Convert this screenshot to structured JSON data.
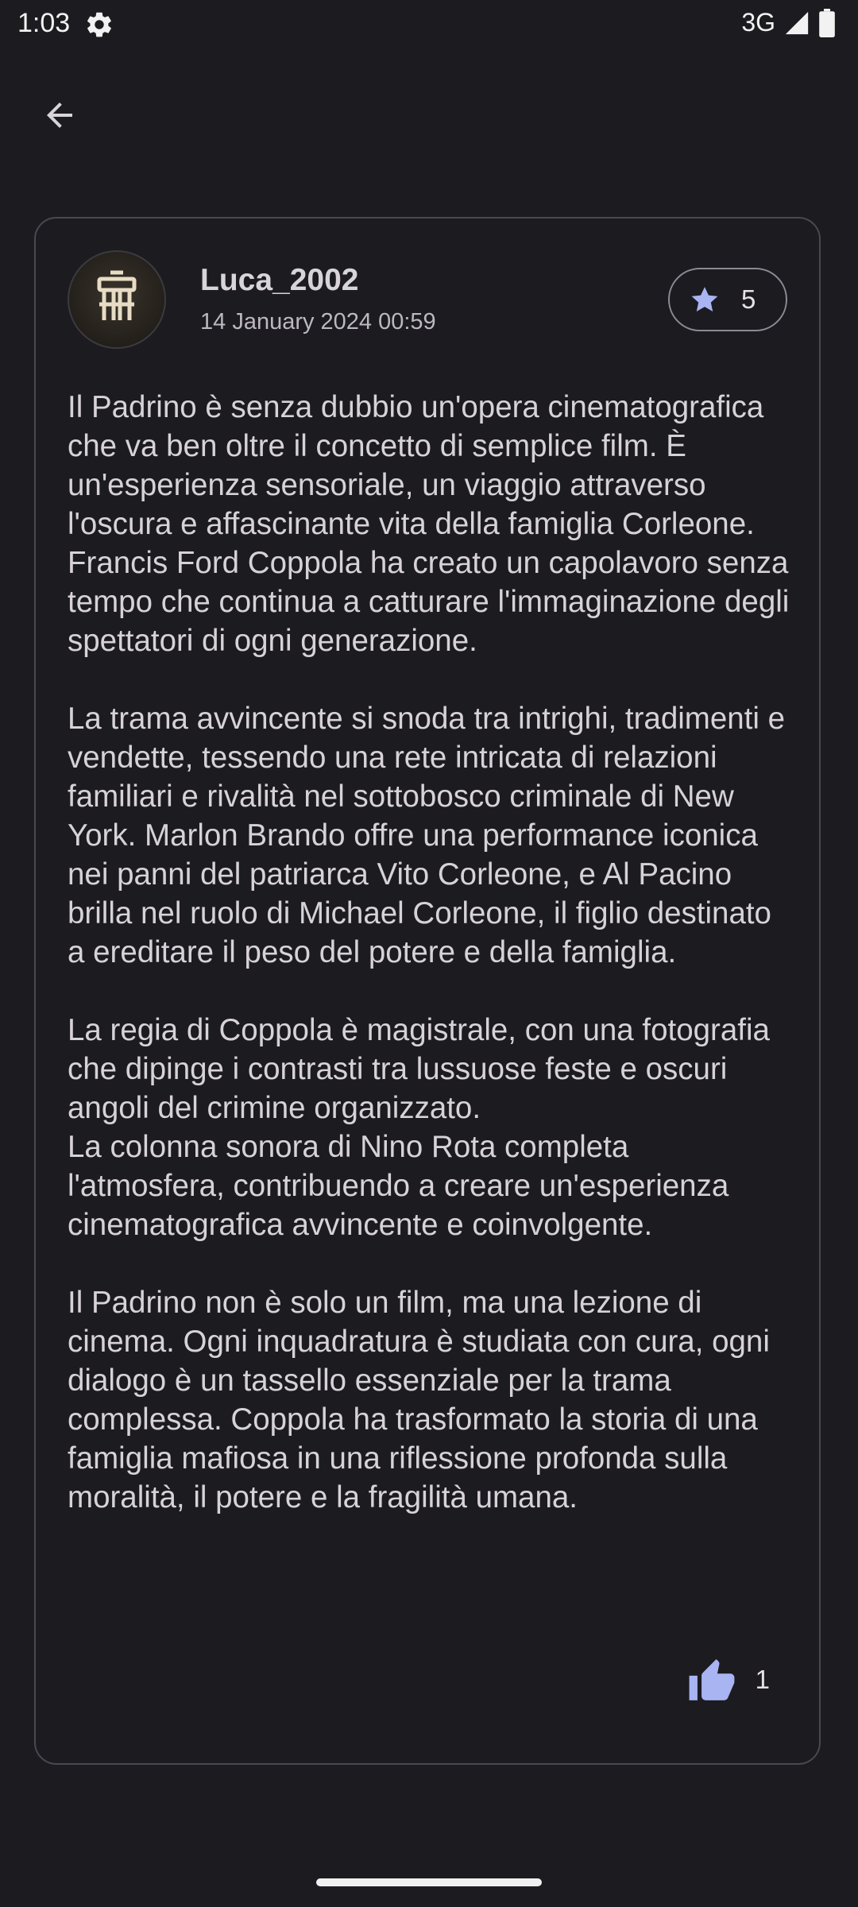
{
  "status_bar": {
    "time": "1:03",
    "network": "3G",
    "icons": [
      "gear-icon",
      "signal-icon",
      "battery-icon"
    ]
  },
  "nav": {
    "back_icon": "arrow-left-icon"
  },
  "review": {
    "username": "Luca_2002",
    "timestamp": "14 January 2024 00:59",
    "rating": "5",
    "rating_icon": "star-icon",
    "paragraphs": [
      "Il Padrino è senza dubbio un'opera cinematografica che va ben oltre il concetto di semplice film. È un'esperienza sensoriale, un viaggio attraverso l'oscura e affascinante vita della famiglia Corleone. Francis Ford Coppola ha creato un capolavoro senza tempo che continua a catturare l'immaginazione degli spettatori di ogni generazione.",
      "La trama avvincente si snoda tra intrighi, tradimenti e vendette, tessendo una rete intricata di relazioni familiari e rivalità nel sottobosco criminale di New York. Marlon Brando offre una performance iconica nei panni del patriarca Vito Corleone, e Al Pacino brilla nel ruolo di Michael Corleone, il figlio destinato a ereditare il peso del potere e della famiglia.",
      "La regia di Coppola è magistrale, con una fotografia che dipinge i contrasti tra lussuose feste e oscuri angoli del crimine organizzato.\nLa colonna sonora di Nino Rota completa l'atmosfera, contribuendo a creare un'esperienza cinematografica avvincente e coinvolgente.",
      "Il Padrino non è solo un film, ma una lezione di cinema. Ogni inquadratura è studiata con cura, ogni dialogo è un tassello essenziale per la trama complessa. Coppola ha trasformato la storia di una famiglia mafiosa in una riflessione profonda sulla moralità, il potere e la fragilità umana."
    ],
    "likes": "1",
    "like_icon": "thumbs-up-icon"
  },
  "colors": {
    "background": "#1c1b20",
    "card_border": "#4a4850",
    "accent": "#a9b4f2",
    "text_primary": "#d6d2d8",
    "text_secondary": "#bcb8bf"
  }
}
